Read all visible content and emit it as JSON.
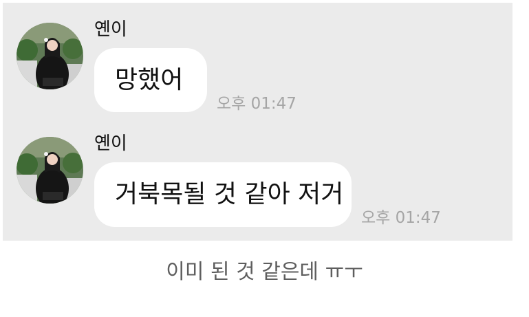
{
  "messages": [
    {
      "sender": "옌이",
      "text": "망했어",
      "time": "오후 01:47"
    },
    {
      "sender": "옌이",
      "text": "거북목될 것 같아 저거",
      "time": "오후 01:47"
    }
  ],
  "caption": "이미 된 것 같은데 ㅠㅜ",
  "colors": {
    "panel_background": "#ebebeb",
    "bubble_background": "#ffffff",
    "timestamp_text": "#a5a5a5",
    "caption_text": "#5e5e5e"
  },
  "icons": {
    "avatar": "profile-photo-avatar-icon"
  }
}
